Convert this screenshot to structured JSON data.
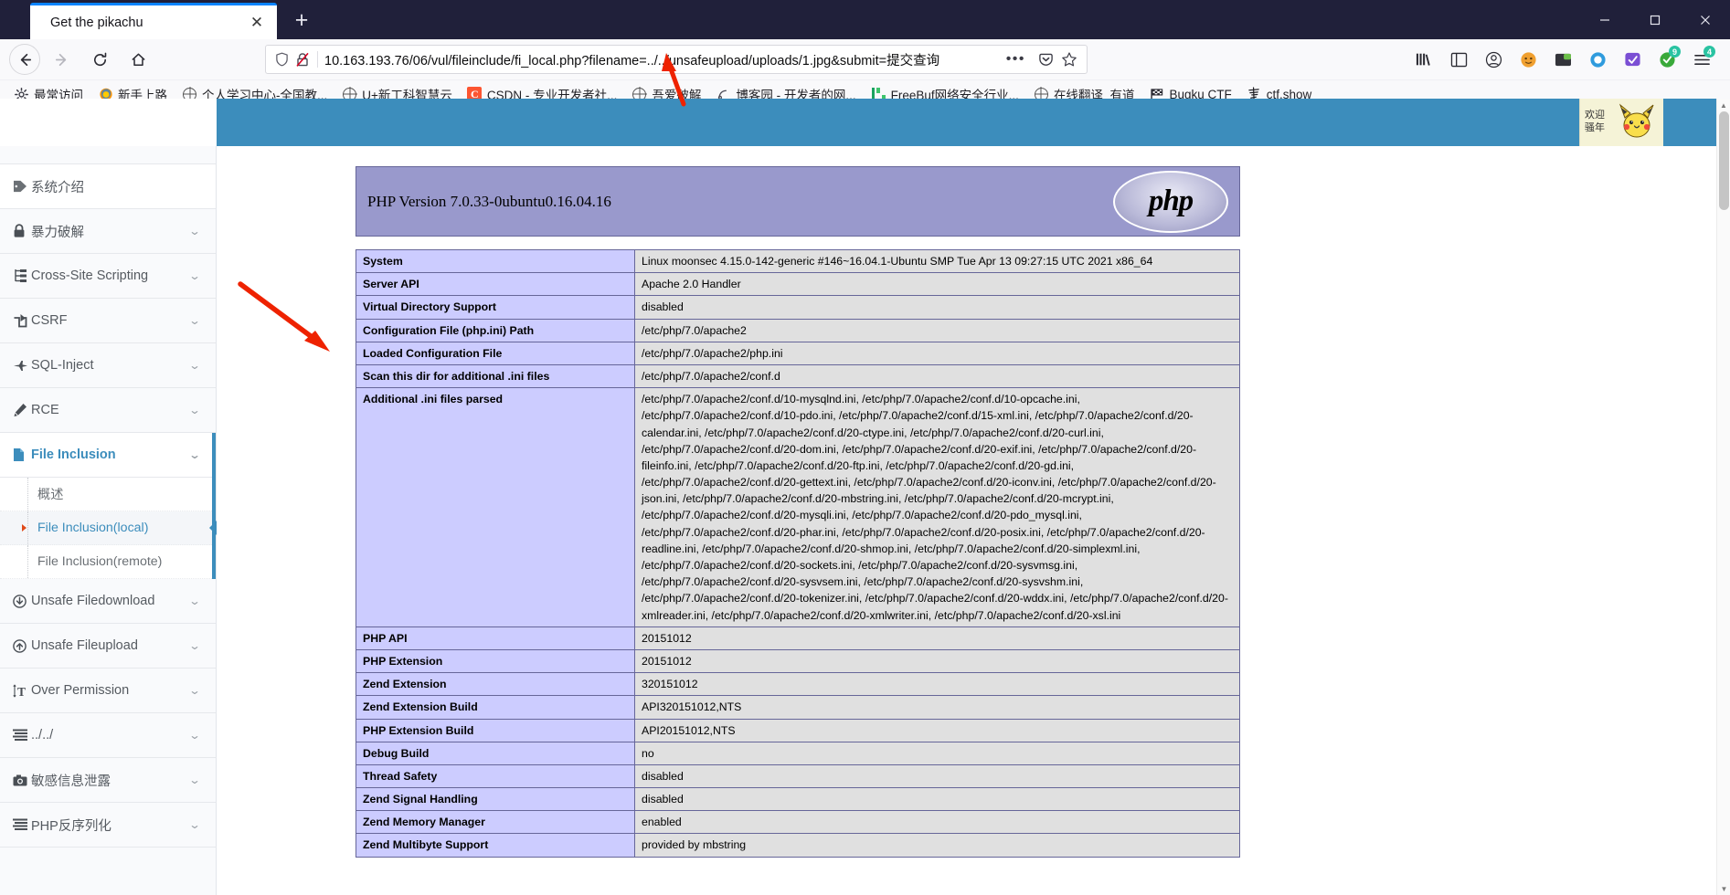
{
  "browser": {
    "tab": {
      "title": "Get the pikachu",
      "close_label": "✕"
    },
    "new_tab_label": "+",
    "window_controls": {
      "minimize": "—",
      "maximize": "☐",
      "close": "✕"
    },
    "nav": {
      "back": "←",
      "forward": "→",
      "reload": "⟳",
      "home": "⌂"
    },
    "url": {
      "host": "10.163.193.76",
      "path": "/06/vul/fileinclude/fi_local.php?filename=../../unsafeupload/uploads/1.jpg&submit=提交查询",
      "full": "10.163.193.76/06/vul/fileinclude/fi_local.php?filename=../../unsafeupload/uploads/1.jpg&submit=提交查询",
      "page_actions_label": "•••",
      "pocket_label": "save-to-pocket",
      "bookmark_label": "bookmark-star"
    },
    "toolbar_icons": [
      {
        "name": "library-icon",
        "glyph": "library"
      },
      {
        "name": "sidebars-icon",
        "glyph": "sidebar"
      },
      {
        "name": "account-icon",
        "glyph": "account"
      },
      {
        "name": "extension-orange-icon",
        "glyph": "orange"
      },
      {
        "name": "extension-dark-icon",
        "glyph": "dark"
      },
      {
        "name": "extension-blue-icon",
        "glyph": "blue"
      },
      {
        "name": "extension-purple-icon",
        "glyph": "purple"
      },
      {
        "name": "extension-green-icon",
        "glyph": "green",
        "badge": "9"
      },
      {
        "name": "app-menu-icon",
        "glyph": "menu",
        "badge": "4"
      }
    ],
    "bookmarks": [
      {
        "label": "最常访问",
        "icon": "gear-icon"
      },
      {
        "label": "新手上路",
        "icon": "firefox-icon"
      },
      {
        "label": "个人学习中心-全国教...",
        "icon": "globe-icon"
      },
      {
        "label": "U+新工科智慧云",
        "icon": "globe-icon"
      },
      {
        "label": "CSDN - 专业开发者社...",
        "icon": "csdn-icon"
      },
      {
        "label": "吾爱破解",
        "icon": "globe-icon"
      },
      {
        "label": "博客园 - 开发者的网...",
        "icon": "cnblogs-icon"
      },
      {
        "label": "FreeBuf网络安全行业...",
        "icon": "freebuf-icon"
      },
      {
        "label": "在线翻译_有道",
        "icon": "globe-icon"
      },
      {
        "label": "Bugku CTF",
        "icon": "flag-icon"
      },
      {
        "label": "ctf.show",
        "icon": "ctfshow-icon"
      }
    ]
  },
  "page": {
    "brand_bar_color": "#3c8dbc",
    "pikachu_badge": {
      "line1": "欢迎",
      "line2": "骚年"
    },
    "sidebar": {
      "items": [
        {
          "label": "系统介绍",
          "icon": "tag-icon",
          "has_chevron": false,
          "state": "normal"
        },
        {
          "label": "暴力破解",
          "icon": "lock-icon",
          "has_chevron": true,
          "state": "normal"
        },
        {
          "label": "Cross-Site Scripting",
          "icon": "sitemap-icon",
          "has_chevron": true,
          "state": "normal"
        },
        {
          "label": "CSRF",
          "icon": "share-icon",
          "has_chevron": true,
          "state": "normal"
        },
        {
          "label": "SQL-Inject",
          "icon": "plane-icon",
          "has_chevron": true,
          "state": "normal"
        },
        {
          "label": "RCE",
          "icon": "pencil-icon",
          "has_chevron": true,
          "state": "normal"
        },
        {
          "label": "File Inclusion",
          "icon": "file-icon",
          "has_chevron": true,
          "state": "active"
        },
        {
          "label": "Unsafe Filedownload",
          "icon": "download-icon",
          "has_chevron": true,
          "state": "normal"
        },
        {
          "label": "Unsafe Fileupload",
          "icon": "upload-icon",
          "has_chevron": true,
          "state": "normal"
        },
        {
          "label": "Over Permission",
          "icon": "text-height-icon",
          "has_chevron": true,
          "state": "normal"
        },
        {
          "label": "../../",
          "icon": "list-icon",
          "has_chevron": true,
          "state": "normal"
        },
        {
          "label": "敏感信息泄露",
          "icon": "camera-icon",
          "has_chevron": true,
          "state": "normal"
        },
        {
          "label": "PHP反序列化",
          "icon": "list-icon",
          "has_chevron": true,
          "state": "normal"
        }
      ],
      "submenu": [
        {
          "label": "概述",
          "selected": false
        },
        {
          "label": "File Inclusion(local)",
          "selected": true
        },
        {
          "label": "File Inclusion(remote)",
          "selected": false
        }
      ]
    },
    "phpinfo": {
      "version_title": "PHP Version 7.0.33-0ubuntu0.16.04.16",
      "logo_text": "php",
      "rows": [
        {
          "key": "System",
          "value": "Linux moonsec 4.15.0-142-generic #146~16.04.1-Ubuntu SMP Tue Apr 13 09:27:15 UTC 2021 x86_64"
        },
        {
          "key": "Server API",
          "value": "Apache 2.0 Handler"
        },
        {
          "key": "Virtual Directory Support",
          "value": "disabled"
        },
        {
          "key": "Configuration File (php.ini) Path",
          "value": "/etc/php/7.0/apache2"
        },
        {
          "key": "Loaded Configuration File",
          "value": "/etc/php/7.0/apache2/php.ini"
        },
        {
          "key": "Scan this dir for additional .ini files",
          "value": "/etc/php/7.0/apache2/conf.d"
        },
        {
          "key": "Additional .ini files parsed",
          "value": "/etc/php/7.0/apache2/conf.d/10-mysqlnd.ini, /etc/php/7.0/apache2/conf.d/10-opcache.ini, /etc/php/7.0/apache2/conf.d/10-pdo.ini, /etc/php/7.0/apache2/conf.d/15-xml.ini, /etc/php/7.0/apache2/conf.d/20-calendar.ini, /etc/php/7.0/apache2/conf.d/20-ctype.ini, /etc/php/7.0/apache2/conf.d/20-curl.ini, /etc/php/7.0/apache2/conf.d/20-dom.ini, /etc/php/7.0/apache2/conf.d/20-exif.ini, /etc/php/7.0/apache2/conf.d/20-fileinfo.ini, /etc/php/7.0/apache2/conf.d/20-ftp.ini, /etc/php/7.0/apache2/conf.d/20-gd.ini, /etc/php/7.0/apache2/conf.d/20-gettext.ini, /etc/php/7.0/apache2/conf.d/20-iconv.ini, /etc/php/7.0/apache2/conf.d/20-json.ini, /etc/php/7.0/apache2/conf.d/20-mbstring.ini, /etc/php/7.0/apache2/conf.d/20-mcrypt.ini, /etc/php/7.0/apache2/conf.d/20-mysqli.ini, /etc/php/7.0/apache2/conf.d/20-pdo_mysql.ini, /etc/php/7.0/apache2/conf.d/20-phar.ini, /etc/php/7.0/apache2/conf.d/20-posix.ini, /etc/php/7.0/apache2/conf.d/20-readline.ini, /etc/php/7.0/apache2/conf.d/20-shmop.ini, /etc/php/7.0/apache2/conf.d/20-simplexml.ini, /etc/php/7.0/apache2/conf.d/20-sockets.ini, /etc/php/7.0/apache2/conf.d/20-sysvmsg.ini, /etc/php/7.0/apache2/conf.d/20-sysvsem.ini, /etc/php/7.0/apache2/conf.d/20-sysvshm.ini, /etc/php/7.0/apache2/conf.d/20-tokenizer.ini, /etc/php/7.0/apache2/conf.d/20-wddx.ini, /etc/php/7.0/apache2/conf.d/20-xmlreader.ini, /etc/php/7.0/apache2/conf.d/20-xmlwriter.ini, /etc/php/7.0/apache2/conf.d/20-xsl.ini"
        },
        {
          "key": "PHP API",
          "value": "20151012"
        },
        {
          "key": "PHP Extension",
          "value": "20151012"
        },
        {
          "key": "Zend Extension",
          "value": "320151012"
        },
        {
          "key": "Zend Extension Build",
          "value": "API320151012,NTS"
        },
        {
          "key": "PHP Extension Build",
          "value": "API20151012,NTS"
        },
        {
          "key": "Debug Build",
          "value": "no"
        },
        {
          "key": "Thread Safety",
          "value": "disabled"
        },
        {
          "key": "Zend Signal Handling",
          "value": "disabled"
        },
        {
          "key": "Zend Memory Manager",
          "value": "enabled"
        },
        {
          "key": "Zend Multibyte Support",
          "value": "provided by mbstring"
        }
      ]
    }
  },
  "scrollbar": {
    "up": "▲",
    "down": "▼"
  }
}
